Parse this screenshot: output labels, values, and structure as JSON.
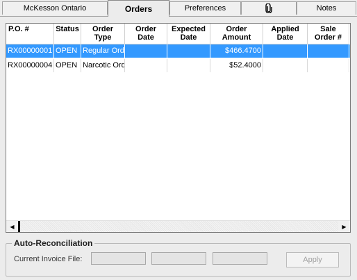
{
  "tabs": [
    {
      "label": "McKesson Ontario"
    },
    {
      "label": "Orders"
    },
    {
      "label": "Preferences"
    },
    {
      "label": ""
    },
    {
      "label": "Notes"
    }
  ],
  "active_tab": "Orders",
  "grid": {
    "columns": [
      "P.O. #",
      "Status",
      "Order\nType",
      "Order\nDate",
      "Expected\nDate",
      "Order\nAmount",
      "Applied\nDate",
      "Sale\nOrder #"
    ],
    "rows": [
      {
        "po": "RX00000001",
        "status": "OPEN",
        "type": "Regular Orde",
        "order_date": "",
        "expected_date": "",
        "amount": "$466.4700",
        "applied_date": "",
        "sale_order": "",
        "selected": true
      },
      {
        "po": "RX00000004",
        "status": "OPEN",
        "type": "Narcotic Ord",
        "order_date": "",
        "expected_date": "",
        "amount": "$52.4000",
        "applied_date": "",
        "sale_order": "",
        "selected": false
      }
    ]
  },
  "auto_reconciliation": {
    "title": "Auto-Reconciliation",
    "invoice_label": "Current Invoice File:",
    "field1_value": "",
    "field2_value": "",
    "field3_value": "",
    "apply_label": "Apply"
  },
  "icons": {
    "attachment_tab": "paperclip-icon"
  }
}
